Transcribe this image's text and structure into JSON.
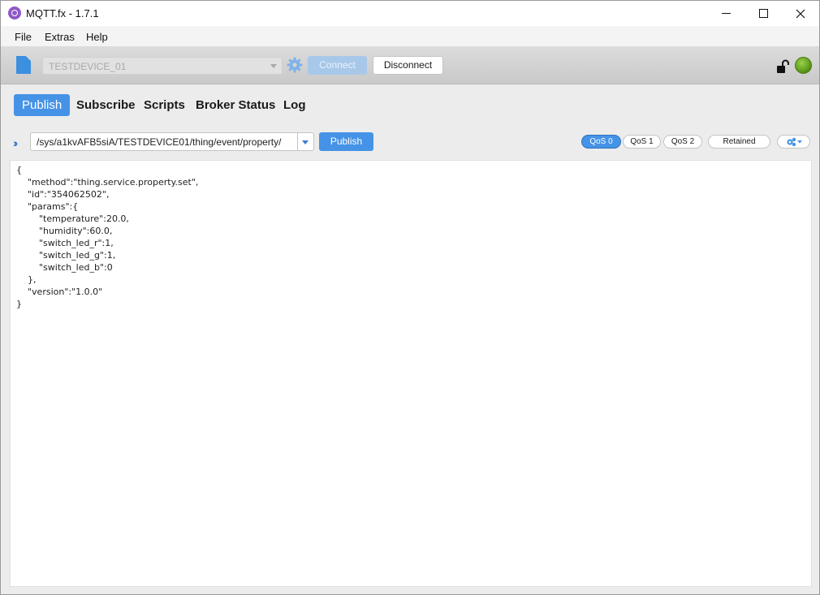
{
  "window": {
    "title": "MQTT.fx - 1.7.1"
  },
  "menu": {
    "items": [
      "File",
      "Extras",
      "Help"
    ]
  },
  "connection": {
    "profile": "TESTDEVICE_01",
    "connect_label": "Connect",
    "disconnect_label": "Disconnect",
    "status_color": "#6aac24"
  },
  "tabs": [
    {
      "label": "Publish",
      "active": true
    },
    {
      "label": "Subscribe"
    },
    {
      "label": "Scripts"
    },
    {
      "label": "Broker Status"
    },
    {
      "label": "Log"
    }
  ],
  "publish": {
    "topic": "/sys/a1kvAFB5siA/TESTDEVICE01/thing/event/property/",
    "publish_label": "Publish",
    "qos": [
      "QoS 0",
      "QoS 1",
      "QoS 2"
    ],
    "qos_selected": "QoS 0",
    "retained_label": "Retained"
  },
  "payload": {
    "text": "{\n    \"method\":\"thing.service.property.set\",\n    \"id\":\"354062502\",\n    \"params\":{\n        \"temperature\":20.0,\n        \"humidity\":60.0,\n        \"switch_led_r\":1,\n        \"switch_led_g\":1,\n        \"switch_led_b\":0\n    },\n    \"version\":\"1.0.0\"\n}"
  },
  "colors": {
    "accent": "#4593e6",
    "connect_disabled": "#a8c8ea",
    "status_led": "#6aac24"
  }
}
